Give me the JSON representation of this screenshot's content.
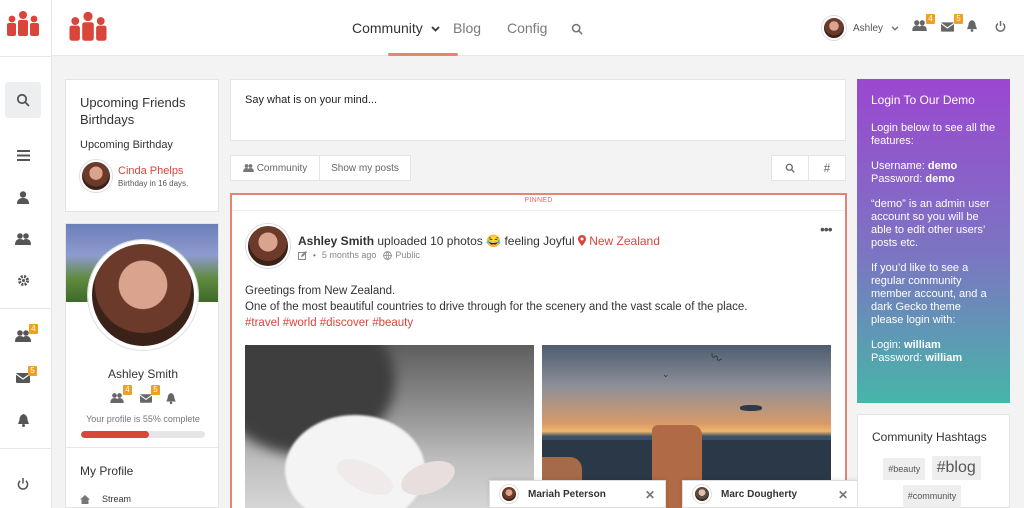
{
  "nav": {
    "community": "Community",
    "blog": "Blog",
    "config": "Config",
    "user_name": "Ashley",
    "friends_badge": "4",
    "messages_badge": "5"
  },
  "rail": {
    "friends_badge": "4",
    "messages_badge": "5"
  },
  "birthdays": {
    "title": "Upcoming Friends Birthdays",
    "subtitle": "Upcoming Birthday",
    "name": "Cinda Phelps",
    "note": "Birthday in 16 days."
  },
  "profile": {
    "name": "Ashley Smith",
    "friends_badge": "4",
    "messages_badge": "5",
    "completion_text": "Your profile is 55% complete",
    "completion": 0.55,
    "my_profile": "My Profile",
    "stream": "Stream"
  },
  "composer": {
    "placeholder": "Say what is on your mind..."
  },
  "toolbar": {
    "community": "Community",
    "show_my_posts": "Show my posts"
  },
  "post": {
    "pinned": "PINNED",
    "author": "Ashley Smith",
    "action": "uploaded 10 photos",
    "feeling": "feeling Joyful",
    "location": "New Zealand",
    "time": "5 months ago",
    "visibility": "Public",
    "line1": "Greetings from New Zealand.",
    "line2": "One of the most beautiful countries to drive through for the scenery and the vast scale of the place.",
    "hashtags": "#travel #world #discover #beauty"
  },
  "chats": [
    {
      "name": "Mariah Peterson"
    },
    {
      "name": "Marc Dougherty"
    }
  ],
  "demo": {
    "title": "Login To Our Demo",
    "intro": "Login below to see all the features:",
    "username_label": "Username:",
    "username": "demo",
    "password_label": "Password:",
    "password": "demo",
    "admin_note_1": "“demo” is an admin user account so you will be able to edit other users’ posts etc.",
    "regular_note": "If you’d like to see a regular community member account, and a dark Gecko theme please login with:",
    "login_label": "Login:",
    "login": "william",
    "password2_label": "Password:",
    "password2": "william"
  },
  "hashtags": {
    "title": "Community Hashtags",
    "tag1": "#beauty",
    "tag2": "#blog",
    "tag3": "#community"
  },
  "colors": {
    "accent": "#d9453b",
    "badge": "#f0a020",
    "demo_top": "#9b47d0",
    "demo_bottom": "#46b6a8"
  }
}
